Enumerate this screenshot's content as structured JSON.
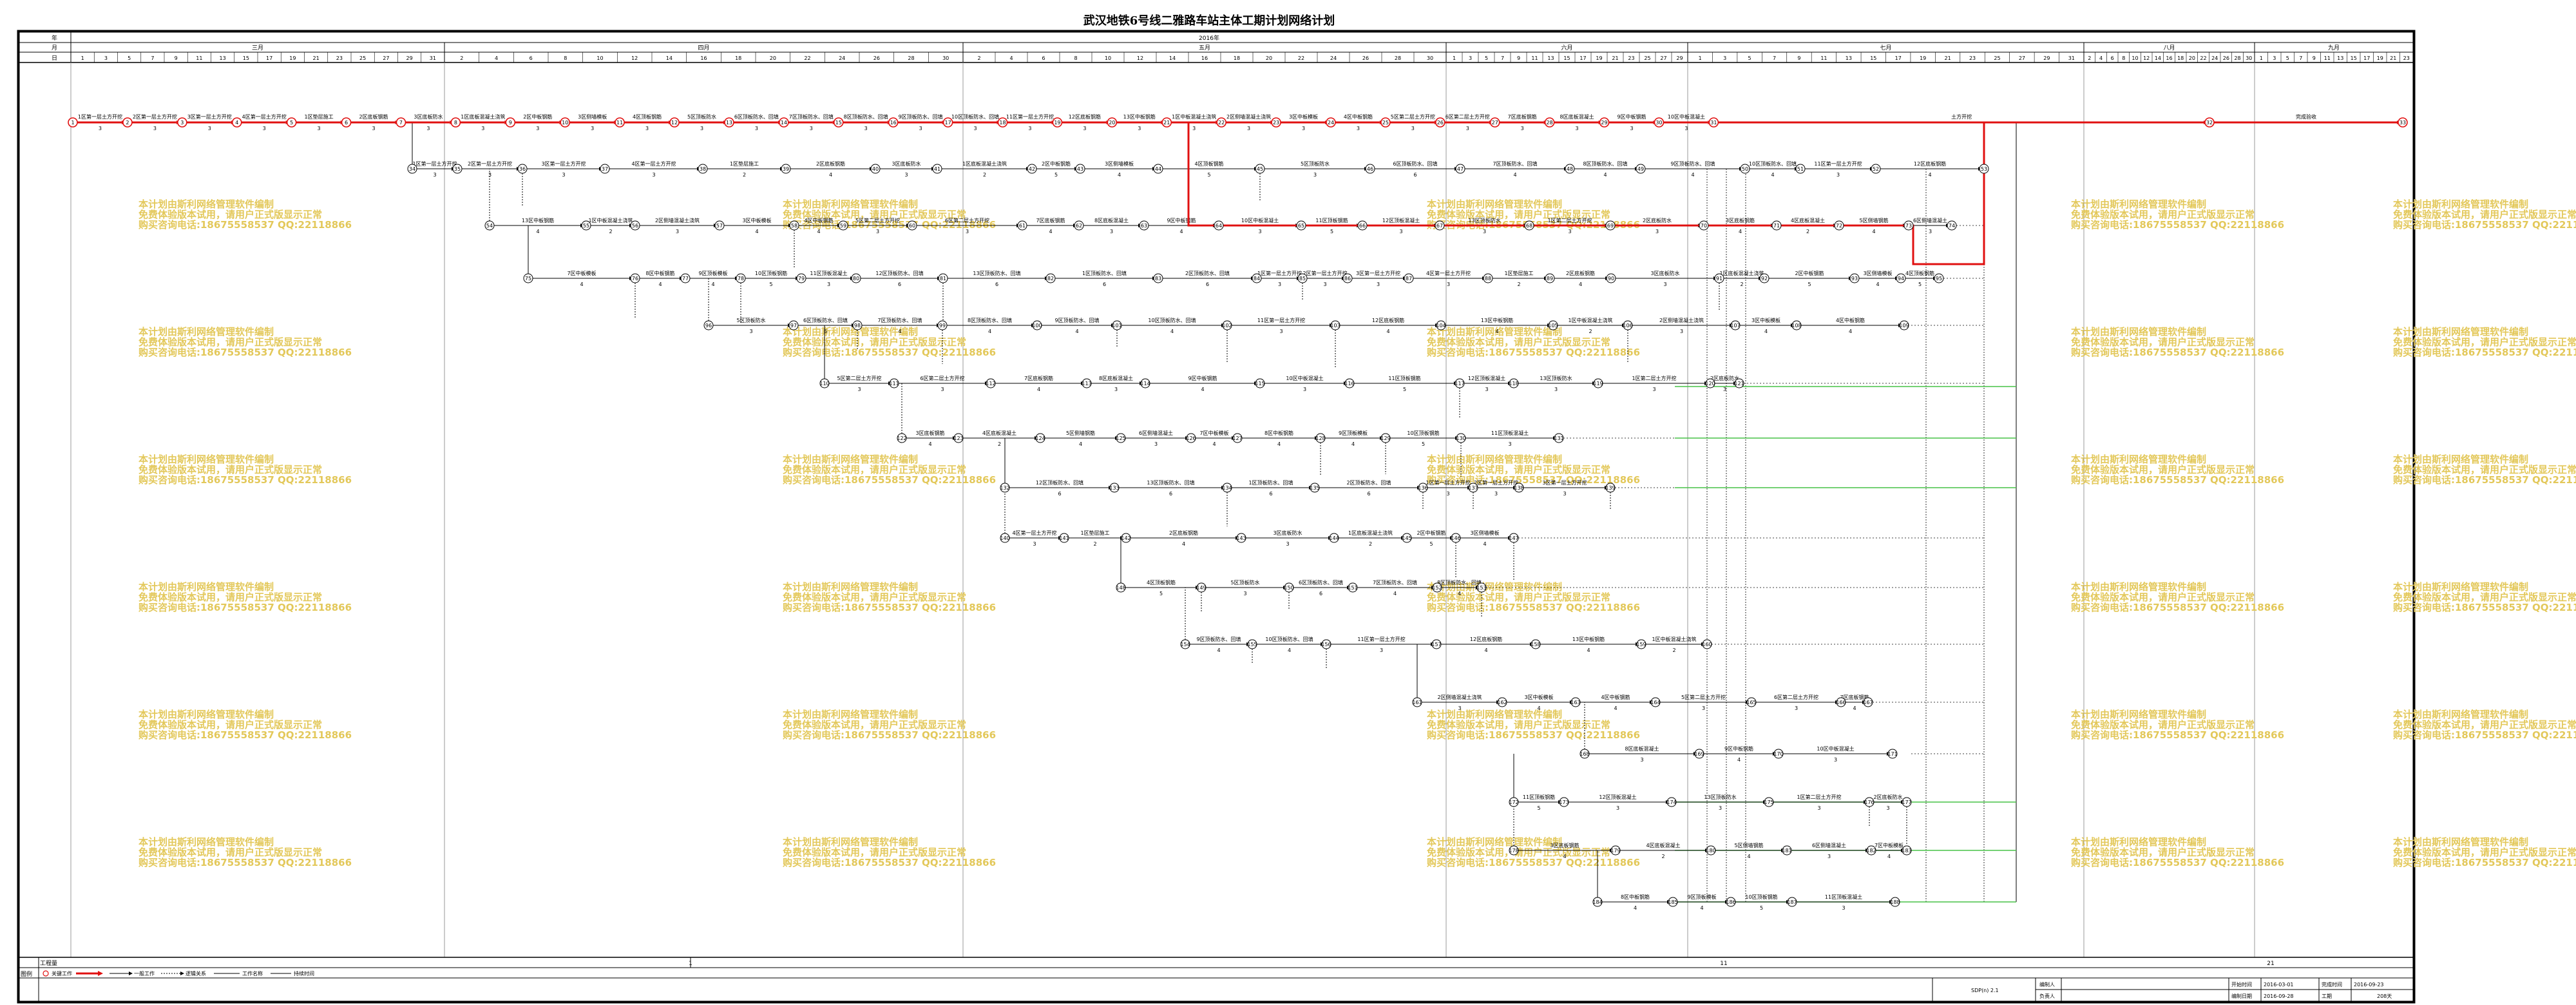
{
  "title": "武汉地铁6号线二雅路车站主体工期计划网络计划",
  "header": {
    "row_labels": [
      "年",
      "月",
      "日"
    ],
    "year_label": "2016年",
    "months": [
      "三月",
      "四月",
      "五月",
      "六月",
      "七月",
      "八月",
      "九月"
    ],
    "days": [
      [
        "1",
        "3",
        "5",
        "7",
        "9",
        "11",
        "13",
        "15",
        "17",
        "19",
        "21",
        "23",
        "25",
        "27",
        "29",
        "31"
      ],
      [
        "2",
        "4",
        "6",
        "8",
        "10",
        "12",
        "14",
        "16",
        "18",
        "20",
        "22",
        "24",
        "26",
        "28",
        "30"
      ],
      [
        "2",
        "4",
        "6",
        "8",
        "10",
        "12",
        "14",
        "16",
        "18",
        "20",
        "22",
        "24",
        "26",
        "28",
        "30"
      ],
      [
        "1",
        "3",
        "5",
        "7",
        "9",
        "11",
        "13",
        "15",
        "17",
        "19",
        "21",
        "23",
        "25",
        "27",
        "29"
      ],
      [
        "1",
        "3",
        "5",
        "7",
        "9",
        "11",
        "13",
        "15",
        "17",
        "19",
        "21",
        "23",
        "25",
        "27",
        "29",
        "31"
      ],
      [
        "2",
        "4",
        "6",
        "8",
        "10",
        "12",
        "14",
        "16",
        "18",
        "20",
        "22",
        "24",
        "26",
        "28",
        "30"
      ],
      [
        "1",
        "3",
        "5",
        "7",
        "9",
        "11",
        "13",
        "15",
        "17",
        "19",
        "21",
        "23"
      ]
    ]
  },
  "footer": {
    "project_row_label": "工程量",
    "project_values": [
      "1",
      "11",
      "21"
    ],
    "legend_label": "图例",
    "legend_items": [
      "关键工作",
      "一般工作",
      "逻辑关系",
      "工作名称",
      "持续时间"
    ],
    "code": "SDP(n) 2.1",
    "sign_rows": [
      {
        "label": "编制人",
        "value": ""
      },
      {
        "label": "负责人",
        "value": ""
      }
    ],
    "meta_pairs": [
      {
        "label": "开始时间",
        "value": "2016-03-01"
      },
      {
        "label": "完成时间",
        "value": "2016-09-23"
      },
      {
        "label": "编制日期",
        "value": "2016-09-28"
      },
      {
        "label": "工期",
        "value": "208天"
      }
    ]
  },
  "watermark": {
    "lines": [
      "本计划由斯利网络管理软件编制",
      "免费体验版本试用，请用户正式版显示正常",
      "购买咨询电话:18675558537 QQ:22118866"
    ]
  },
  "critical_path": {
    "label_top": "土方开挖",
    "label_end": "完成验收",
    "durations": [
      "3",
      "3",
      "3",
      "3",
      "3",
      "3",
      "3",
      "3",
      "3",
      "3",
      "3",
      "3",
      "3",
      "3",
      "3",
      "3",
      "3",
      "3",
      "3",
      "3",
      "3",
      "3",
      "3",
      "3",
      "3",
      "3",
      "3",
      "3",
      "3",
      "3"
    ]
  },
  "activities": [
    {
      "name": "1区第一层土方开挖",
      "dur": "3"
    },
    {
      "name": "2区第一层土方开挖",
      "dur": "3"
    },
    {
      "name": "3区第一层土方开挖",
      "dur": "3"
    },
    {
      "name": "4区第一层土方开挖",
      "dur": "3"
    },
    {
      "name": "1区垫层施工",
      "dur": "2"
    },
    {
      "name": "2区底板钢筋",
      "dur": "4"
    },
    {
      "name": "3区底板防水",
      "dur": "3"
    },
    {
      "name": "1区底板混凝土浇筑",
      "dur": "2"
    },
    {
      "name": "2区中板钢筋",
      "dur": "5"
    },
    {
      "name": "3区侧墙模板",
      "dur": "4"
    },
    {
      "name": "4区顶板钢筋",
      "dur": "5"
    },
    {
      "name": "5区顶板防水",
      "dur": "3"
    },
    {
      "name": "6区顶板防水、回填",
      "dur": "6"
    },
    {
      "name": "7区顶板防水、回填",
      "dur": "4"
    },
    {
      "name": "8区顶板防水、回填",
      "dur": "4"
    },
    {
      "name": "9区顶板防水、回填",
      "dur": "4"
    },
    {
      "name": "10区顶板防水、回填",
      "dur": "4"
    },
    {
      "name": "11区第一层土方开挖",
      "dur": "3"
    },
    {
      "name": "12区底板钢筋",
      "dur": "4"
    },
    {
      "name": "13区中板钢筋",
      "dur": "4"
    },
    {
      "name": "1区中板混凝土浇筑",
      "dur": "2"
    },
    {
      "name": "2区侧墙混凝土浇筑",
      "dur": "3"
    },
    {
      "name": "3区中板模板",
      "dur": "4"
    },
    {
      "name": "4区中板钢筋",
      "dur": "4"
    },
    {
      "name": "5区第二层土方开挖",
      "dur": "3"
    },
    {
      "name": "6区第二层土方开挖",
      "dur": "3"
    },
    {
      "name": "7区底板钢筋",
      "dur": "4"
    },
    {
      "name": "8区底板混凝土",
      "dur": "3"
    },
    {
      "name": "9区中板钢筋",
      "dur": "4"
    },
    {
      "name": "10区中板混凝土",
      "dur": "3"
    },
    {
      "name": "11区顶板钢筋",
      "dur": "5"
    },
    {
      "name": "12区顶板混凝土",
      "dur": "3"
    },
    {
      "name": "13区顶板防水",
      "dur": "3"
    },
    {
      "name": "1区第二层土方开挖",
      "dur": "3"
    },
    {
      "name": "2区底板防水",
      "dur": "3"
    },
    {
      "name": "3区底板钢筋",
      "dur": "4"
    },
    {
      "name": "4区底板混凝土",
      "dur": "2"
    },
    {
      "name": "5区侧墙钢筋",
      "dur": "4"
    },
    {
      "name": "6区侧墙混凝土",
      "dur": "3"
    },
    {
      "name": "7区中板模板",
      "dur": "4"
    },
    {
      "name": "8区中板钢筋",
      "dur": "4"
    },
    {
      "name": "9区顶板模板",
      "dur": "4"
    },
    {
      "name": "10区顶板钢筋",
      "dur": "5"
    },
    {
      "name": "11区顶板混凝土",
      "dur": "3"
    },
    {
      "name": "12区顶板防水、回填",
      "dur": "6"
    },
    {
      "name": "13区顶板防水、回填",
      "dur": "6"
    },
    {
      "name": "1区顶板防水、回填",
      "dur": "6"
    },
    {
      "name": "2区顶板防水、回填",
      "dur": "6"
    }
  ]
}
